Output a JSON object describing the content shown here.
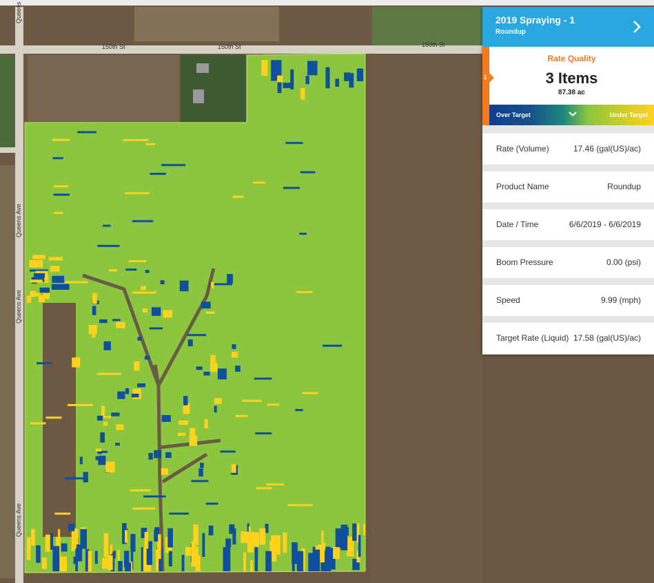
{
  "map": {
    "roads": {
      "street_labels": [
        "150th St",
        "150th St",
        "150th St"
      ],
      "avenue_labels": [
        "Queens",
        "Queens Ave",
        "Queens Ave",
        "Queens Ave"
      ]
    },
    "colors": {
      "on_target": "#8cc63f",
      "over_target": "#0e4f9e",
      "under_target": "#ffd21f",
      "soil": "#6e5a44",
      "road": "#d8d4c8"
    }
  },
  "panel": {
    "title": "2019 Spraying - 1",
    "subtitle": "Roundup",
    "header_icon": "chevron-right-icon",
    "quality": {
      "tab_number": "1",
      "label": "Rate Quality",
      "items": "3 Items",
      "acres": "87.38 ac",
      "legend_over": "Over Target",
      "legend_under": "Under Target",
      "legend_icon": "chevron-down-icon"
    },
    "rows": [
      {
        "label": "Rate (Volume)",
        "value": "17.46 (gal(US)/ac)"
      },
      {
        "label": "Product Name",
        "value": "Roundup"
      },
      {
        "label": "Date / Time",
        "value": "6/6/2019 - 6/6/2019"
      },
      {
        "label": "Boom Pressure",
        "value": "0.00 (psi)"
      },
      {
        "label": "Speed",
        "value": "9.99 (mph)"
      },
      {
        "label": "Target Rate (Liquid)",
        "value": "17.58 (gal(US)/ac)"
      }
    ]
  }
}
